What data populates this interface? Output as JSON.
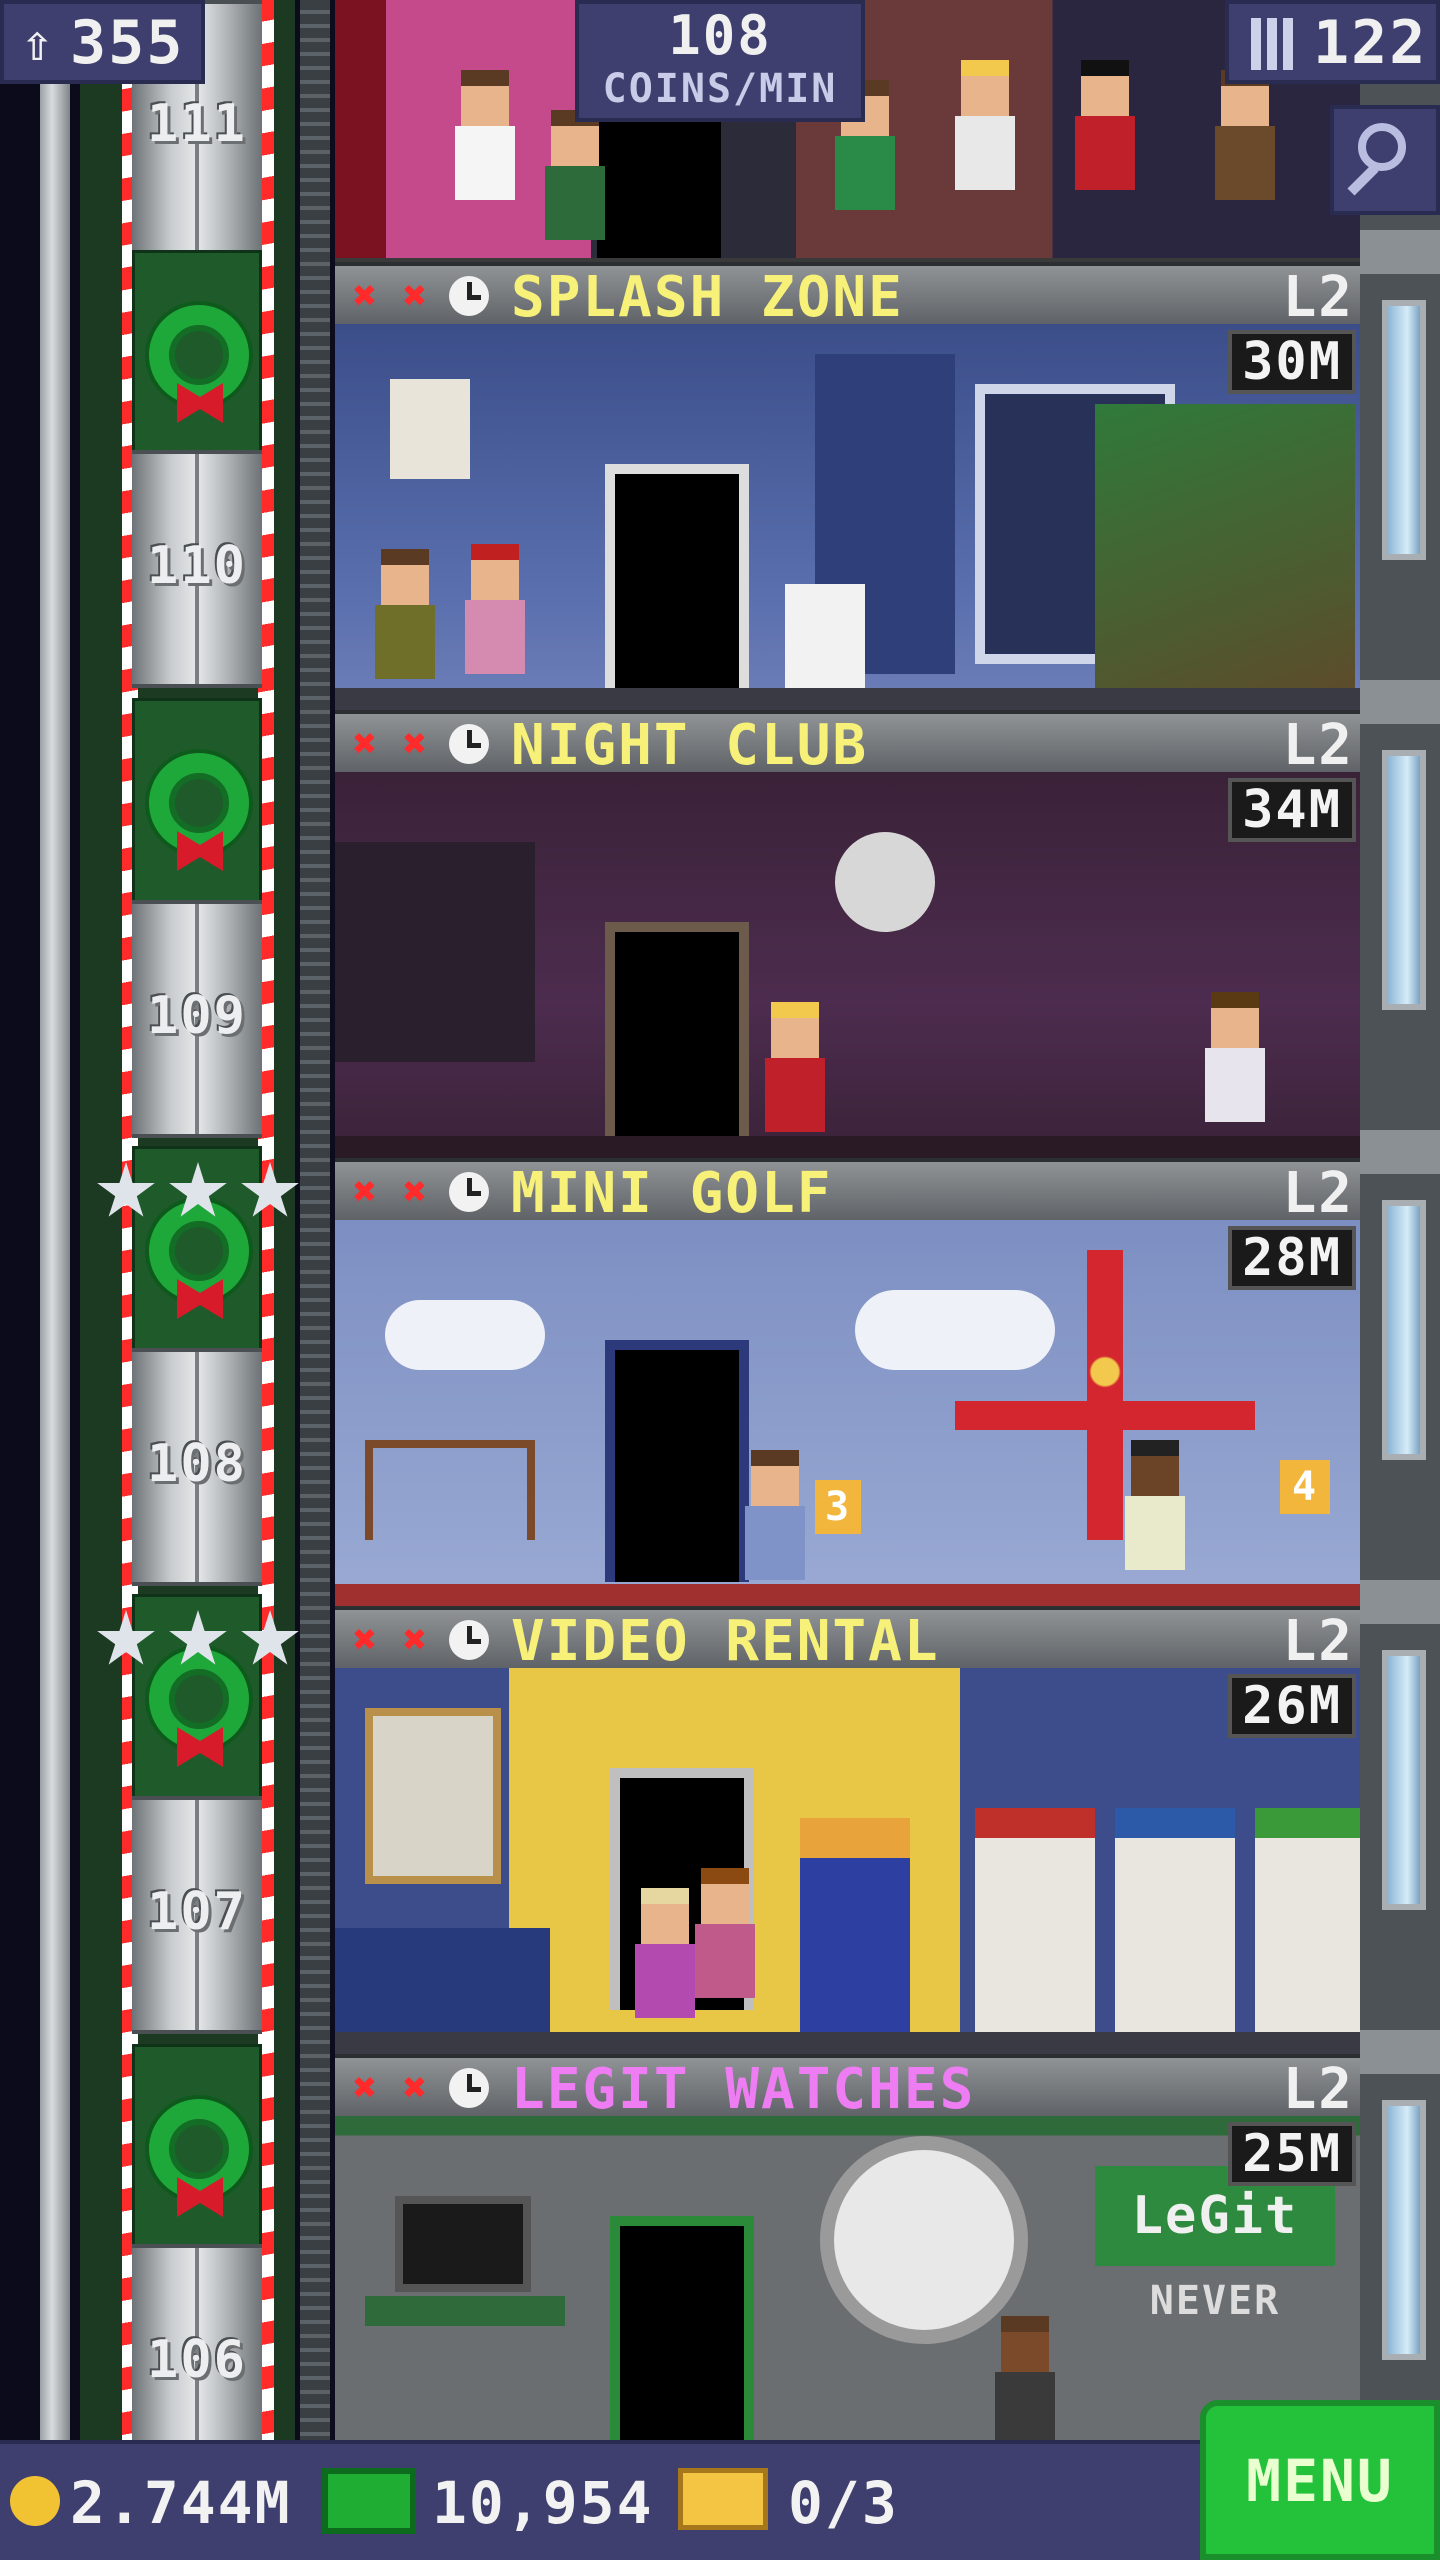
{
  "hud": {
    "population": "355",
    "coins_rate_value": "108",
    "coins_rate_unit": "COINS/MIN",
    "floor_count": "122"
  },
  "shaft": {
    "floor_numbers": [
      "111",
      "110",
      "109",
      "108",
      "107",
      "106"
    ]
  },
  "floors": [
    {
      "name": "SPLASH ZONE",
      "level": "L2",
      "earnings": "30M"
    },
    {
      "name": "NIGHT CLUB",
      "level": "L2",
      "earnings": "34M"
    },
    {
      "name": "MINI GOLF",
      "level": "L2",
      "earnings": "28M"
    },
    {
      "name": "VIDEO RENTAL",
      "level": "L2",
      "earnings": "26M"
    },
    {
      "name": "LEGIT WATCHES",
      "level": "L2",
      "earnings": "25M"
    }
  ],
  "scenery": {
    "golf_flag_left": "3",
    "golf_flag_right": "4",
    "watch_sign_line1": "LeGit",
    "watch_sign_line2": "NEVER"
  },
  "bottom_bar": {
    "coins": "2.744M",
    "bux": "10,954",
    "tickets": "0/3"
  },
  "menu": {
    "label": "MENU"
  },
  "colors": {
    "hud_bg": "#3e3f6e",
    "room_name": "#f7f17a",
    "room_name_special": "#ee7cf2",
    "menu_green": "#23c23a"
  },
  "icons": {
    "population": "person-up-icon",
    "floors": "building-icon",
    "search": "magnifier-icon",
    "coin": "coin-icon",
    "bux": "bux-icon",
    "ticket": "vip-ticket-icon"
  }
}
